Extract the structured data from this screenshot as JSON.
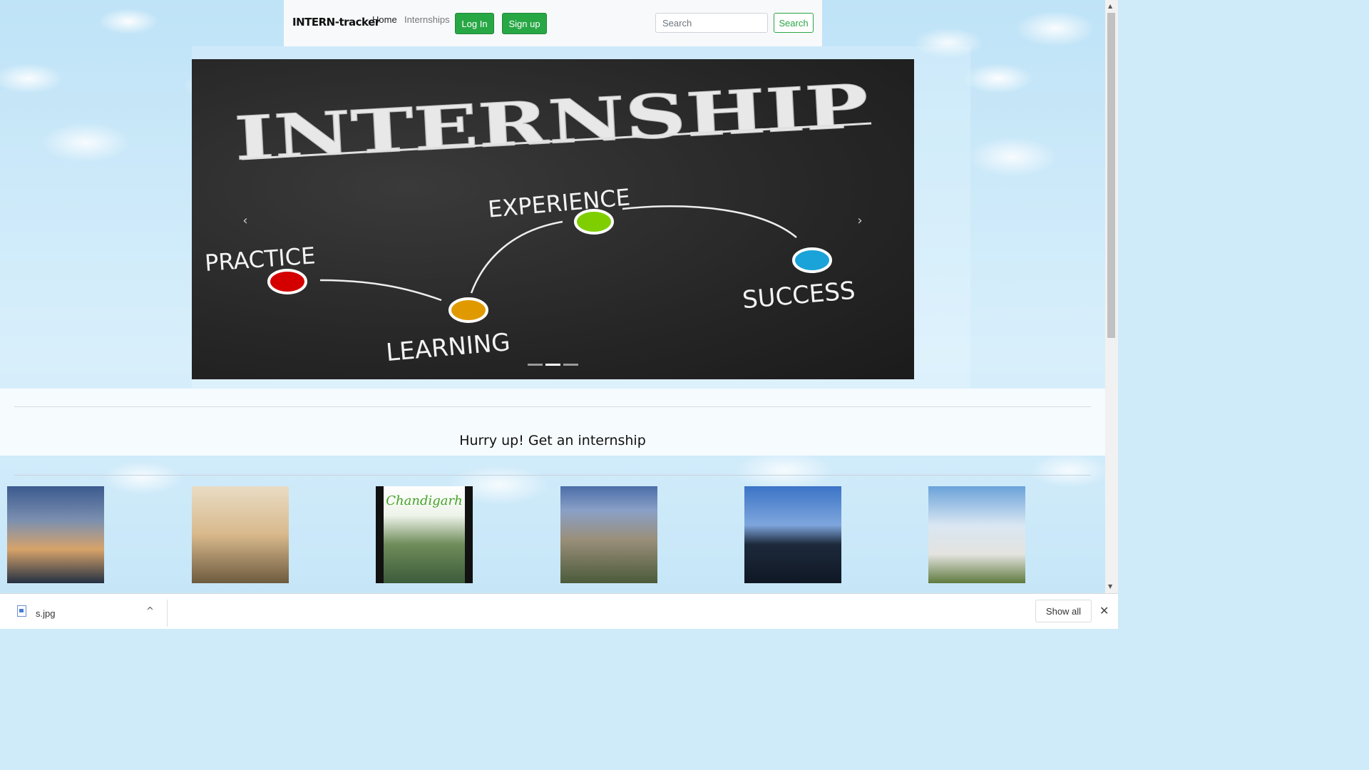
{
  "navbar": {
    "brand": "INTERN-tracker",
    "links": {
      "home": "Home",
      "internships": "Internships"
    },
    "login_label": "Log In",
    "signup_label": "Sign up",
    "search_placeholder": "Search",
    "search_button": "Search"
  },
  "carousel": {
    "slide_text": {
      "title": "INTERNSHIP",
      "practice": "PRACTICE",
      "learning": "LEARNING",
      "experience": "EXPERIENCE",
      "success": "SUCCESS"
    },
    "prev_icon": "‹",
    "next_icon": "›",
    "indicators": 3,
    "active_index": 1
  },
  "section": {
    "heading": "Hurry up! Get an internship"
  },
  "thumbnails": {
    "chandigarh_label": "Chandigarh"
  },
  "downloads": {
    "file_name": "s.jpg",
    "show_all": "Show all",
    "close_icon": "✕",
    "chevron_icon": "^"
  },
  "colors": {
    "accent_green": "#28a745",
    "chalkboard": "#262626"
  }
}
